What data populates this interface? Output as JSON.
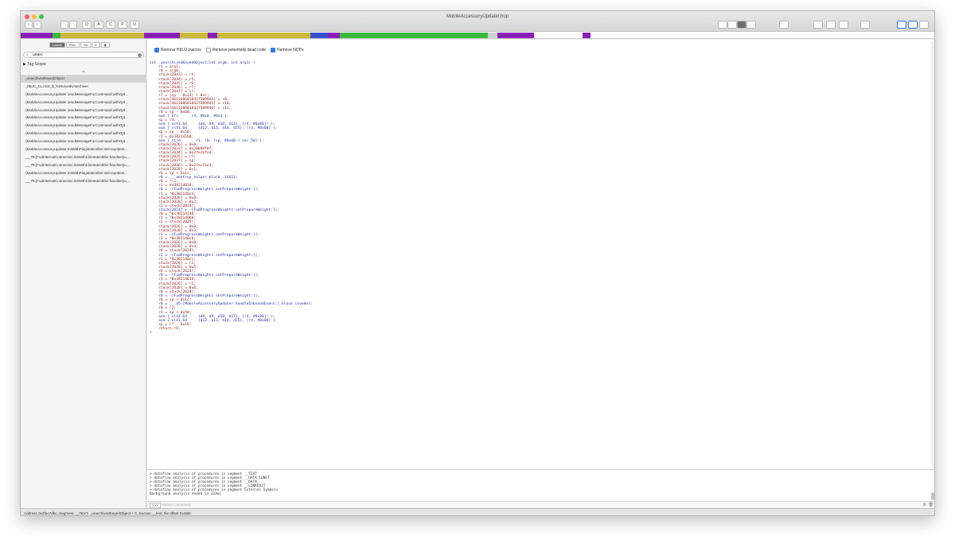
{
  "app": {
    "window_title": "MobileAccessoryUpdater.hop",
    "mode_buttons": [
      "D",
      "A",
      "C",
      "P",
      "U"
    ]
  },
  "colors": {
    "olive": "#c9b83a",
    "purple": "#8a1fb8",
    "green": "#3cb83c",
    "blue": "#3a4fd0",
    "gray": "#d0d0d0"
  },
  "sidebar": {
    "tabs": [
      "Labels",
      "Proc.",
      "Str",
      "n",
      "◉"
    ],
    "search_value": "unarc",
    "tag_scope": "Tag Scope",
    "symbols": [
      "_unarchivedKeyedObject",
      "_OBJC_CLASS_$_NSKeyedUnarchiver",
      "-[MobileAccessoryUpdater sendMessageForCommand:withOpt...",
      "-[MobileAccessoryUpdater sendMessageForCommand:withOpt...",
      "-[MobileAccessoryUpdater sendMessageForCommand:withOpt...",
      "-[MobileAccessoryUpdater sendMessageForCommand:withOpt...",
      "-[MobileAccessoryUpdater sendMessageForCommand:withOpt...",
      "-[MobileAccessoryUpdater sendMessageForCommand:withOpt...",
      "-[MobileAccessoryUpdater sendMessageForCommand:withOpt...",
      "-[MobileAccessoryUpdater initWithPluginIdentifier:isGroupIdent...",
      "___78-[FudInternalConnection initWithClientIdentifier:handlerQu...",
      "___78-[FudInternalConnection initWithClientIdentifier:handlerQu...",
      "-[MobileAccessoryUpdater initWithPluginIdentifier:isGroupIdent...",
      "___78-[FudInternalConnection initWithClientIdentifier:handlerQu..."
    ]
  },
  "options": {
    "remove_hilo": "Remove HI/LO macros",
    "remove_dead": "Remove potentially dead code",
    "remove_nops": "Remove NOPs"
  },
  "code": {
    "signature": "int _unarchivedKeyedObject(int arg0, int arg1) {",
    "lines": [
      "    r1 = arg1;",
      "    r0 = arg0;",
      "    stack[2043] = r4;",
      "    stack[2044] = r5;",
      "    stack[2045] = r6;",
      "    stack[2046] = r7;",
      "    stack[2047] = lr;",
      "    r7 = (sp - 0x14) + 0xc;",
      "    stack[4611686018427389944] = r8;",
      "    stack[4611686018427389945] = r10;",
      "    stack[4611686018427389946] = r11;",
      "    r4 = sp - 0x60;",
      "    asm { bfc      r4, #0x0, #0x4 };",
      "    sp = r4;",
      "    asm { vst1.64     {d8, d9, d10, d11}, [r4, #0x80]! };",
      "    asm { vst1.64     {d12, d13, d14, d15}, [r4, #0x80] };",
      "    sp = sp - 0x50;",
      "    r2 = 0x38214160;",
      "    asm { strd       r1, r0, [sp, #0x68 + var_50] };",
      "    stack[2026] = 0x0;",
      "    stack[2033] = 0x20096fbf;",
      "    stack[2034] = 0x2fecbfe4;",
      "    stack[2035] = r7;",
      "    stack[2037] = sp;",
      "    stack[2036] = 0x2fec7ee3;",
      "    stack[2028] = 0x1;",
      "    r0 = sp + 0x1c;",
      "    r0 = ___destroy_helper_block_.14611;",
      "    r0 = *r2;",
      "    r1 = 0x38214034;",
      "    r0 = -[FudProgressWeights setPrepareWeight:](;",
      "    r1 = *0x382140c4;",
      "    stack[2026] = 0x0;",
      "    stack[2028] = 0x2;",
      "    r2 = stack[2024];",
      "    stack[2024] = -[FudProgressWeights setPrepareWeight:](;",
      "    r0 = *0x38214140;",
      "    r1 = *0x382140b8;",
      "    r2 = stack[2025];",
      "    stack[2026] = 0x0;",
      "    stack[2028] = 0x3;",
      "    r2 = -[FudProgressWeights setPrepareWeight:](;",
      "    r1 = *0x382140c8;",
      "    stack[2026] = 0x0;",
      "    stack[2028] = 0x4;",
      "    r0 = stack[2024];",
      "    r2 = -[FudProgressWeights setPrepareWeight:](;",
      "    r1 = *0x382140cc;",
      "    stack[2026] = r2;",
      "    stack[2028] = 0x5;",
      "    r0 = stack[2024];",
      "    r0 = -[FudProgressWeights setPrepareWeight:](;",
      "    r1 = *0x38214010;",
      "    stack[2026] = r2;",
      "    stack[2028] = 0x6;",
      "    r0 = stack[2024];",
      "    r0 = -[FudProgressWeights setPrepareWeight:](;",
      "    r0 = sp + 0x1c;",
      "    r0 = ___45-[MobileAccessoryUpdater handleInboundEvent:]_block_invoke(;",
      "    r0 = r2;",
      "    r4 = sp + 0x50;",
      "    asm { vld1.64     {d8, d9, d10, d11}, [r4, #0x80]! };",
      "    asm { vld1.64     {d12, d13, d14, d15}, [r4, #0x80] };",
      "    sp = r7 - 0x10;",
      "    return r0;",
      "}"
    ]
  },
  "console": {
    "lines": [
      "> dataflow analysis of procedures in segment __TEXT",
      "> dataflow analysis of procedures in segment __DATA_CONST",
      "> dataflow analysis of procedures in segment __DATA",
      "> dataflow analysis of procedures in segment __LINKEDIT",
      "> dataflow analysis of procedures in segment External Symbols",
      "Background analysis ended in 333ms"
    ],
    "prompt": ">>>",
    "placeholder": "Python Command"
  },
  "status": {
    "text": "Address 0x2fec7dbc, Segment __TEXT, _unarchivedKeyedObject + 0, Section __text, file offset 0x2dbc"
  }
}
